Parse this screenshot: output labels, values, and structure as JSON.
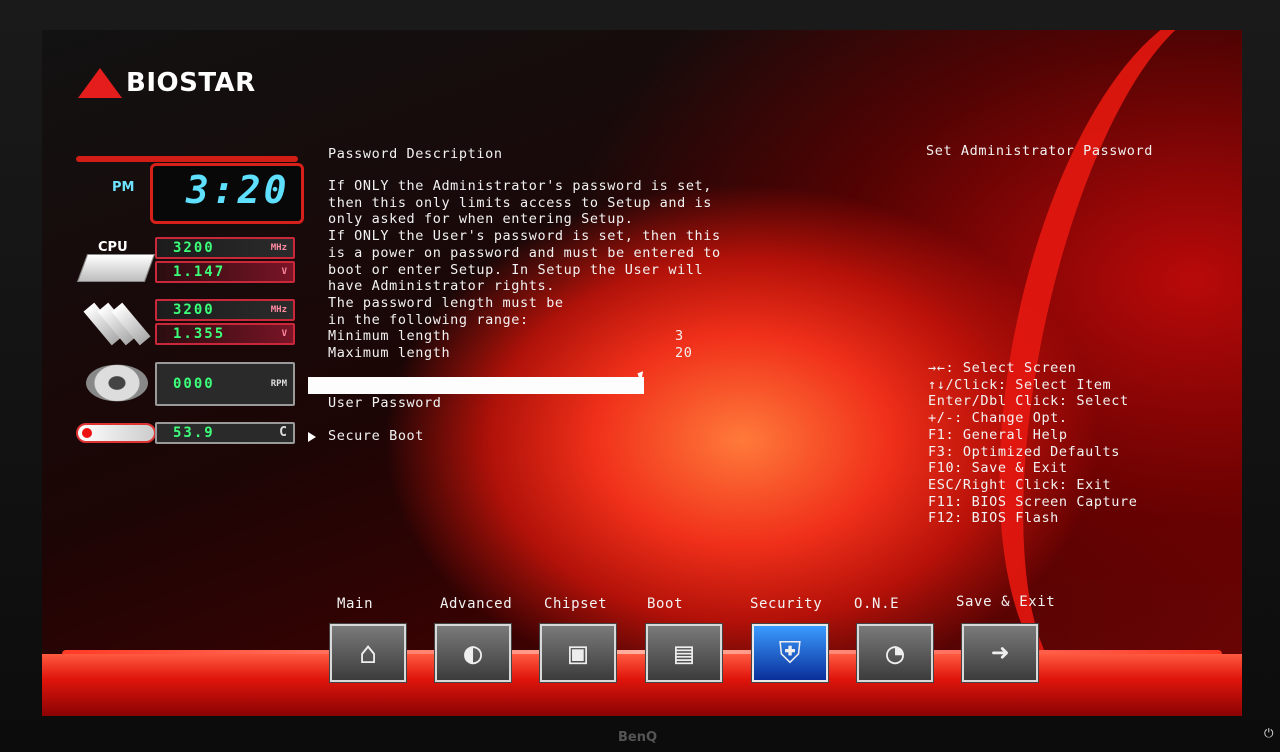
{
  "brand": "BIOSTAR",
  "clock": {
    "ampm": "PM",
    "time": "3:20"
  },
  "hardware": {
    "cpu_label": "CPU",
    "cpu_freq": "3200",
    "cpu_freq_unit": "MHz",
    "cpu_volt": "1.147",
    "cpu_volt_unit": "V",
    "mem_freq": "3200",
    "mem_freq_unit": "MHz",
    "mem_volt": "1.355",
    "mem_volt_unit": "V",
    "fan_rpm": "0000",
    "fan_unit": "RPM",
    "temp": "53.9",
    "temp_unit": "C"
  },
  "description": {
    "title": "Password Description",
    "lines": [
      "If ONLY the Administrator's password is set,",
      "then this only limits access to Setup and is",
      "only asked for when entering Setup.",
      "If ONLY the User's password is set, then this",
      "is a power on password and must be entered to",
      "boot or enter Setup. In Setup the User will",
      "have Administrator rights.",
      "The password length must be",
      "in the following range:"
    ],
    "min_label": "Minimum length",
    "min_value": "3",
    "max_label": "Maximum length",
    "max_value": "20"
  },
  "menu": {
    "selected_item": "",
    "user_password": "User Password",
    "secure_boot": "Secure Boot"
  },
  "help": {
    "title": "Set Administrator Password",
    "keys": [
      "→←: Select Screen",
      "↑↓/Click: Select Item",
      "Enter/Dbl Click: Select",
      "+/-: Change Opt.",
      "F1: General Help",
      "F3: Optimized Defaults",
      "F10: Save & Exit",
      "ESC/Right Click: Exit",
      "F11: BIOS Screen Capture",
      "F12: BIOS Flash"
    ]
  },
  "tabs": [
    {
      "label": "Main",
      "icon": "home-icon"
    },
    {
      "label": "Advanced",
      "icon": "satellite-icon"
    },
    {
      "label": "Chipset",
      "icon": "chip-icon"
    },
    {
      "label": "Boot",
      "icon": "drive-icon"
    },
    {
      "label": "Security",
      "icon": "shield-icon"
    },
    {
      "label": "O.N.E",
      "icon": "gauge-icon"
    },
    {
      "label": "Save & Exit",
      "icon": "exit-icon"
    }
  ],
  "active_tab": "Security",
  "monitor_brand": "BenQ"
}
